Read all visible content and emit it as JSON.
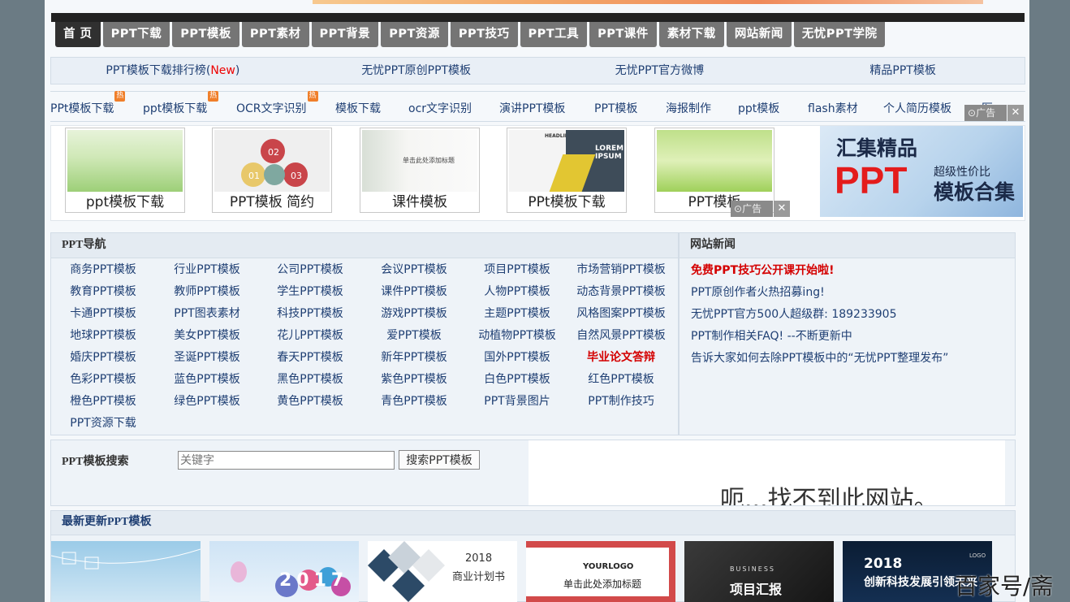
{
  "nav": {
    "items": [
      "首 页",
      "PPT下载",
      "PPT模板",
      "PPT素材",
      "PPT背景",
      "PPT资源",
      "PPT技巧",
      "PPT工具",
      "PPT课件",
      "素材下载",
      "网站新闻",
      "无忧PPT学院"
    ]
  },
  "links_row": {
    "items": [
      {
        "text": "PPT模板下载排行榜(",
        "new": "New",
        "close": ")"
      },
      {
        "text": "无忧PPT原创PPT模板"
      },
      {
        "text": "无忧PPT官方微博"
      },
      {
        "text": "精品PPT模板"
      }
    ]
  },
  "tags_row": {
    "hot_badge": "热",
    "items": [
      "PPt模板下载",
      "ppt模板下载",
      "OCR文字识别",
      "模板下载",
      "ocr文字识别",
      "演讲PPT模板",
      "PPT模板",
      "海报制作",
      "ppt模板",
      "flash素材",
      "个人简历模板",
      "医"
    ],
    "ad_label": "广告",
    "close": "✕"
  },
  "thumbs": {
    "captions": [
      "ppt模板下载",
      "PPT模板 简约",
      "课件模板",
      "PPt模板下载",
      "PPT模板"
    ],
    "ad_label": "广告",
    "close": "✕",
    "sample_title": "单击此处添加标题",
    "headline": "HEADLINE 2",
    "lorem": "LOREM IPSUM"
  },
  "big_ad": {
    "line1": "汇集精品",
    "line2": "PPT",
    "line3": "超级性价比",
    "line4": "模板合集"
  },
  "ppt_nav": {
    "title": "PPT导航",
    "rows": [
      [
        "商务PPT模板",
        "行业PPT模板",
        "公司PPT模板",
        "会议PPT模板",
        "项目PPT模板",
        "市场营销PPT模板"
      ],
      [
        "教育PPT模板",
        "教师PPT模板",
        "学生PPT模板",
        "课件PPT模板",
        "人物PPT模板",
        "动态背景PPT模板"
      ],
      [
        "卡通PPT模板",
        "PPT图表素材",
        "科技PPT模板",
        "游戏PPT模板",
        "主题PPT模板",
        "风格图案PPT模板"
      ],
      [
        "地球PPT模板",
        "美女PPT模板",
        "花儿PPT模板",
        "爱PPT模板",
        "动植物PPT模板",
        "自然风景PPT模板"
      ],
      [
        "婚庆PPT模板",
        "圣诞PPT模板",
        "春天PPT模板",
        "新年PPT模板",
        "国外PPT模板",
        "毕业论文答辩"
      ],
      [
        "色彩PPT模板",
        "蓝色PPT模板",
        "黑色PPT模板",
        "紫色PPT模板",
        "白色PPT模板",
        "红色PPT模板"
      ],
      [
        "橙色PPT模板",
        "绿色PPT模板",
        "黄色PPT模板",
        "青色PPT模板",
        "PPT背景图片",
        "PPT制作技巧"
      ],
      [
        "PPT资源下载"
      ]
    ],
    "highlight": "毕业论文答辩"
  },
  "news": {
    "title": "网站新闻",
    "items": [
      "免费PPT技巧公开课开始啦!",
      "PPT原创作者火热招募ing!",
      "无忧PPT官方500人超级群: 189233905",
      "PPT制作相关FAQ! --不断更新中",
      "告诉大家如何去除PPT模板中的“无忧PPT整理发布”"
    ]
  },
  "search": {
    "label": "PPT模板搜索",
    "placeholder": "关键字",
    "button": "搜索PPT模板",
    "frame_error": "呃...找不到此网站。"
  },
  "latest": {
    "title": "最新更新PPT模板",
    "year1": "2017",
    "year2": "2018",
    "year3": "2018",
    "plan": "商业计划书",
    "yourlogo": "YOURLOGO",
    "click_title": "单击此处添加标题",
    "business": "BUSINESS",
    "report": "项目汇报",
    "tech": "创新科技发展引领未来",
    "logo": "LOGO"
  },
  "watermark": "百家号/斋"
}
